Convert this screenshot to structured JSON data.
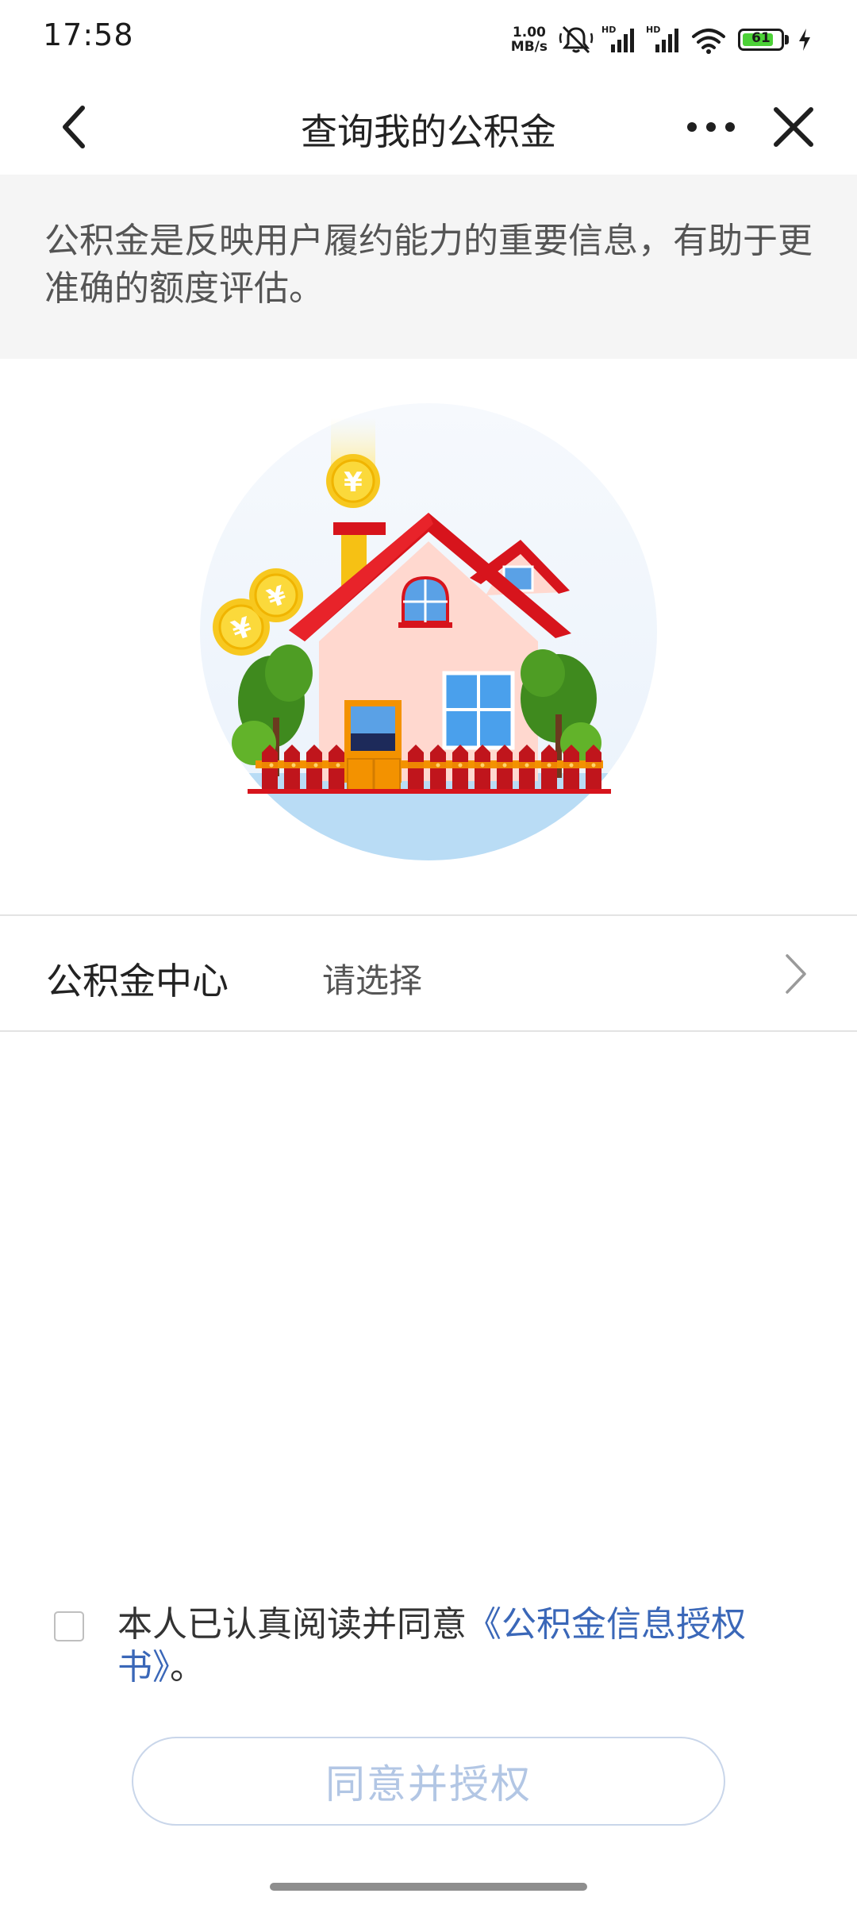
{
  "status_bar": {
    "time": "17:58",
    "net_speed_value": "1.00",
    "net_speed_unit": "MB/s",
    "signal_label_1": "HD",
    "signal_label_2": "HD",
    "battery_level": "61",
    "icons": [
      "mute-icon",
      "signal-hd-icon",
      "signal-hd-icon",
      "wifi-icon",
      "battery-icon",
      "charging-icon"
    ]
  },
  "nav": {
    "title": "查询我的公积金",
    "back_icon": "chevron-left-icon",
    "more_icon": "more-icon",
    "close_icon": "close-icon"
  },
  "notice": {
    "text": "公积金是反映用户履约能力的重要信息，有助于更准确的额度评估。"
  },
  "illustration": {
    "name": "house-with-coins",
    "coin_symbol": "¥"
  },
  "form": {
    "center_label": "公积金中心",
    "center_placeholder": "请选择"
  },
  "agreement": {
    "text_prefix": "本人已认真阅读并同意",
    "link_text": "《公积金信息授权书》",
    "text_suffix": "。",
    "checked": false
  },
  "actions": {
    "agree_button": "同意并授权"
  },
  "colors": {
    "link": "#3a67b8",
    "button_text_disabled": "#b2c6e4",
    "notice_bg": "#f5f5f5"
  }
}
